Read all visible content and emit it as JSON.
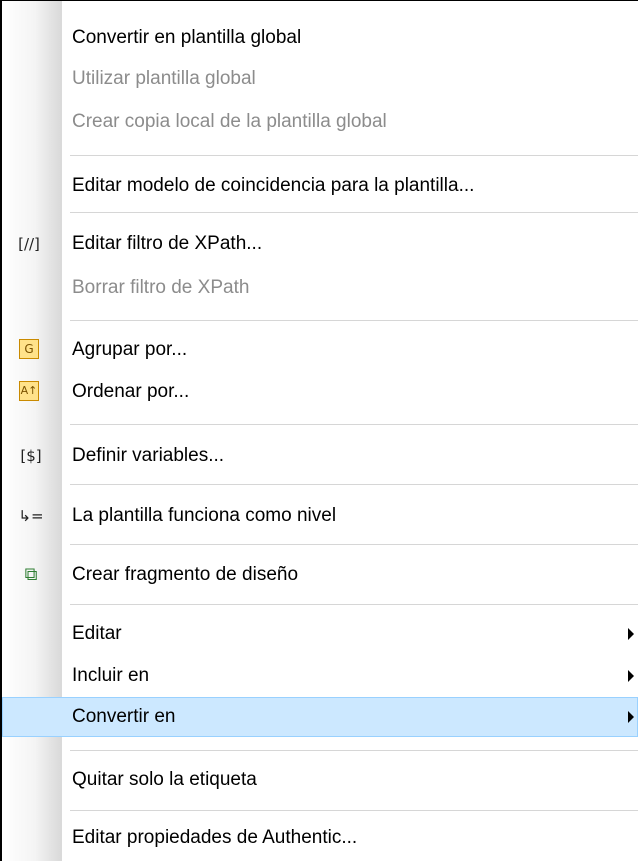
{
  "menu": {
    "items": [
      {
        "label": "Convertir en plantilla global"
      },
      {
        "label": "Utilizar plantilla global"
      },
      {
        "label": "Crear copia local de la plantilla global"
      },
      {
        "label": "Editar modelo de coincidencia para la plantilla..."
      },
      {
        "label": "Editar filtro de XPath...",
        "icon_text": "[//]"
      },
      {
        "label": "Borrar filtro de XPath"
      },
      {
        "label": "Agrupar por...",
        "icon_text": "G"
      },
      {
        "label": "Ordenar por...",
        "icon_text": "A↑"
      },
      {
        "label": "Definir variables...",
        "icon_text": "[$]"
      },
      {
        "label": "La plantilla funciona como nivel",
        "icon_text": "↳="
      },
      {
        "label": "Crear fragmento de diseño",
        "icon_text": "⧉"
      },
      {
        "label": "Editar"
      },
      {
        "label": "Incluir en"
      },
      {
        "label": "Convertir en"
      },
      {
        "label": "Quitar solo la etiqueta"
      },
      {
        "label": "Editar propiedades de Authentic..."
      }
    ]
  }
}
